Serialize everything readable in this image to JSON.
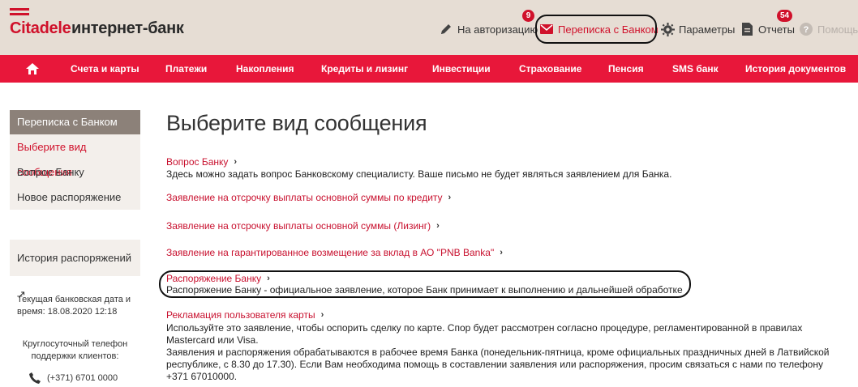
{
  "header": {
    "brand": "Citadele",
    "product": "интернет-банк",
    "auth_label": "На авторизацию",
    "messages_label": "Переписка с Банком",
    "messages_badge": "9",
    "params_label": "Параметры",
    "reports_label": "Отчеты",
    "reports_badge": "54",
    "help_label": "Помощь",
    "brand_color": "#d0112b",
    "nav_color": "#e8173a"
  },
  "nav": {
    "items": [
      "Счета и карты",
      "Платежи",
      "Накопления",
      "Кредиты и лизинг",
      "Инвестиции",
      "Страхование",
      "Пенсия",
      "SMS банк",
      "История документов"
    ]
  },
  "sidebar": {
    "title": "Переписка с Банком",
    "items": [
      "Выберите вид сообщения",
      "Вопрос Банку",
      "Новое распоряжение"
    ],
    "history": "История распоряжений ↗",
    "date_text": "Текущая банковская дата и время: 18.08.2020 12:18",
    "phone_label": "Круглосуточный телефон поддержки клиентов:",
    "phone": "(+371) 6701 0000"
  },
  "main": {
    "title": "Выберите вид сообщения",
    "options": [
      {
        "link": "Вопрос Банку",
        "desc": "Здесь можно задать вопрос Банковскому специалисту. Ваше письмо не будет являться заявлением для Банка."
      },
      {
        "link": "Заявление на отсрочку выплаты основной суммы по кредиту",
        "desc": ""
      },
      {
        "link": "Заявление на отсрочку выплаты основной суммы (Лизинг)",
        "desc": ""
      },
      {
        "link": "Заявление на гарантированное возмещение за вклад в АО \"PNB Banka\"",
        "desc": ""
      },
      {
        "link": "Распоряжение Банку",
        "desc": "Распоряжение Банку - официальное заявление, которое Банк принимает к выполнению и дальнейшей обработке"
      },
      {
        "link": "Рекламация пользователя карты",
        "desc": "Используйте это заявление, чтобы оспорить сделку по карте. Спор будет рассмотрен согласно процедуре, регламентированной в правилах Mastercard или Visa."
      }
    ],
    "footer_note": "Заявления и распоряжения обрабатываются в рабочее время Банка (понедельник-пятница, кроме официальных праздничных дней в Латвийской республике, с 8.30 до 17.30). Если Вам необходима помощь в составлении заявления или распоряжения, просим связаться с нами по телефону +371 67010000."
  }
}
